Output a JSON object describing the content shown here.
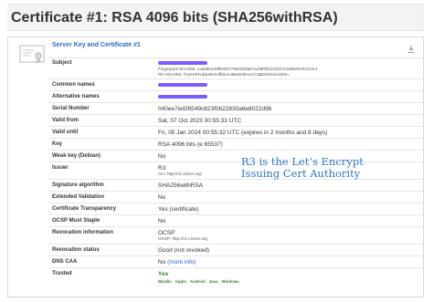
{
  "page": {
    "title": "Certificate #1: RSA 4096 bits (SHA256withRSA)"
  },
  "panel": {
    "title": "Server Key and Certificate #1",
    "icon_name": "certificate-icon",
    "download_icon": "download-icon"
  },
  "rows": {
    "subject": {
      "label": "Subject",
      "fingerprint": "Fingerprint SHA256: ca3a8e249f8e6b77682303be7a1f8f0f31e3237419d5287012c0c1",
      "pin": "Pin SHA256: TuvmHRL6bUBmUfbbuAJBMuNkAvUCJBDDXKloLDDe="
    },
    "common_names": {
      "label": "Common names"
    },
    "alternative_names": {
      "label": "Alternative names"
    },
    "serial_number": {
      "label": "Serial Number",
      "value": "040ee7ed26549c823f0b22830a6e8022d9b"
    },
    "valid_from": {
      "label": "Valid from",
      "value": "Sat, 07 Oct 2023 00:55:33 UTC"
    },
    "valid_until": {
      "label": "Valid until",
      "value": "Fri, 05 Jan 2024 00:55:32 UTC (expires in 2 months and 8 days)"
    },
    "key": {
      "label": "Key",
      "value": "RSA 4096 bits (e 65537)"
    },
    "weak_key": {
      "label": "Weak key (Debian)",
      "value": "No"
    },
    "issuer": {
      "label": "Issuer",
      "value": "R3",
      "aia": "AIA: http://r3.i.lencr.org/"
    },
    "signature_algorithm": {
      "label": "Signature algorithm",
      "value": "SHA256withRSA"
    },
    "extended_validation": {
      "label": "Extended Validation",
      "value": "No"
    },
    "certificate_transparency": {
      "label": "Certificate Transparency",
      "value": "Yes (certificate)"
    },
    "ocsp_must_staple": {
      "label": "OCSP Must Staple",
      "value": "No"
    },
    "revocation_information": {
      "label": "Revocation information",
      "value": "OCSP",
      "sub": "OCSP: http://r3.o.lencr.org"
    },
    "revocation_status": {
      "label": "Revocation status",
      "value": "Good (not revoked)"
    },
    "dns_caa": {
      "label": "DNS CAA",
      "value_prefix": "No ",
      "link": "(more info)"
    },
    "trusted": {
      "label": "Trusted",
      "value": "Yes",
      "clients": [
        "Mozilla",
        "Apple",
        "Android",
        "Java",
        "Windows"
      ]
    }
  },
  "annotation": {
    "line1": "R3 is the Let’s Encrypt",
    "line2": "Issuing Cert Authority"
  },
  "colors": {
    "accent": "#2a6fbf",
    "green": "#2e8b2e",
    "orange": "#d07a1a",
    "redaction": "#7d5cff"
  }
}
